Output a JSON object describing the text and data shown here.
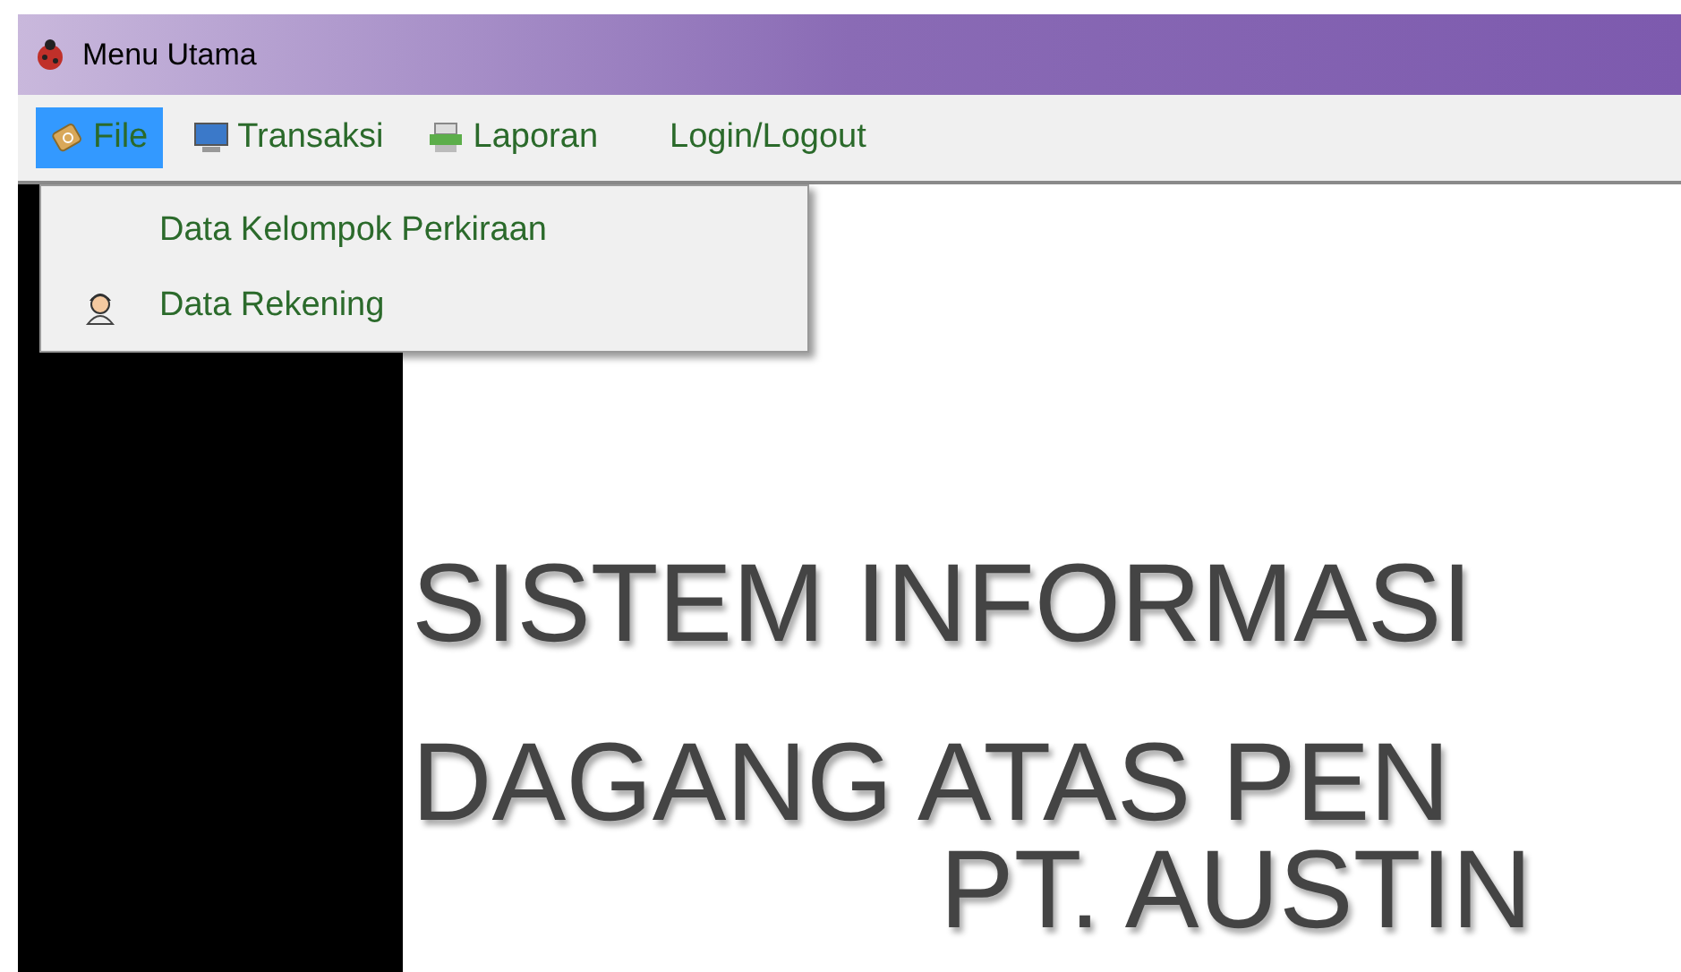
{
  "window": {
    "title": "Menu Utama"
  },
  "menu": [
    {
      "label": "File",
      "selected": true
    },
    {
      "label": "Transaksi",
      "selected": false
    },
    {
      "label": "Laporan",
      "selected": false
    },
    {
      "label": "Login/Logout",
      "selected": false
    }
  ],
  "dropdown": [
    {
      "label": "Data Kelompok Perkiraan"
    },
    {
      "label": "Data Rekening"
    }
  ],
  "banner": [
    "SISTEM INFORMASI",
    "DAGANG ATAS PEN",
    "PT. AUSTIN"
  ]
}
